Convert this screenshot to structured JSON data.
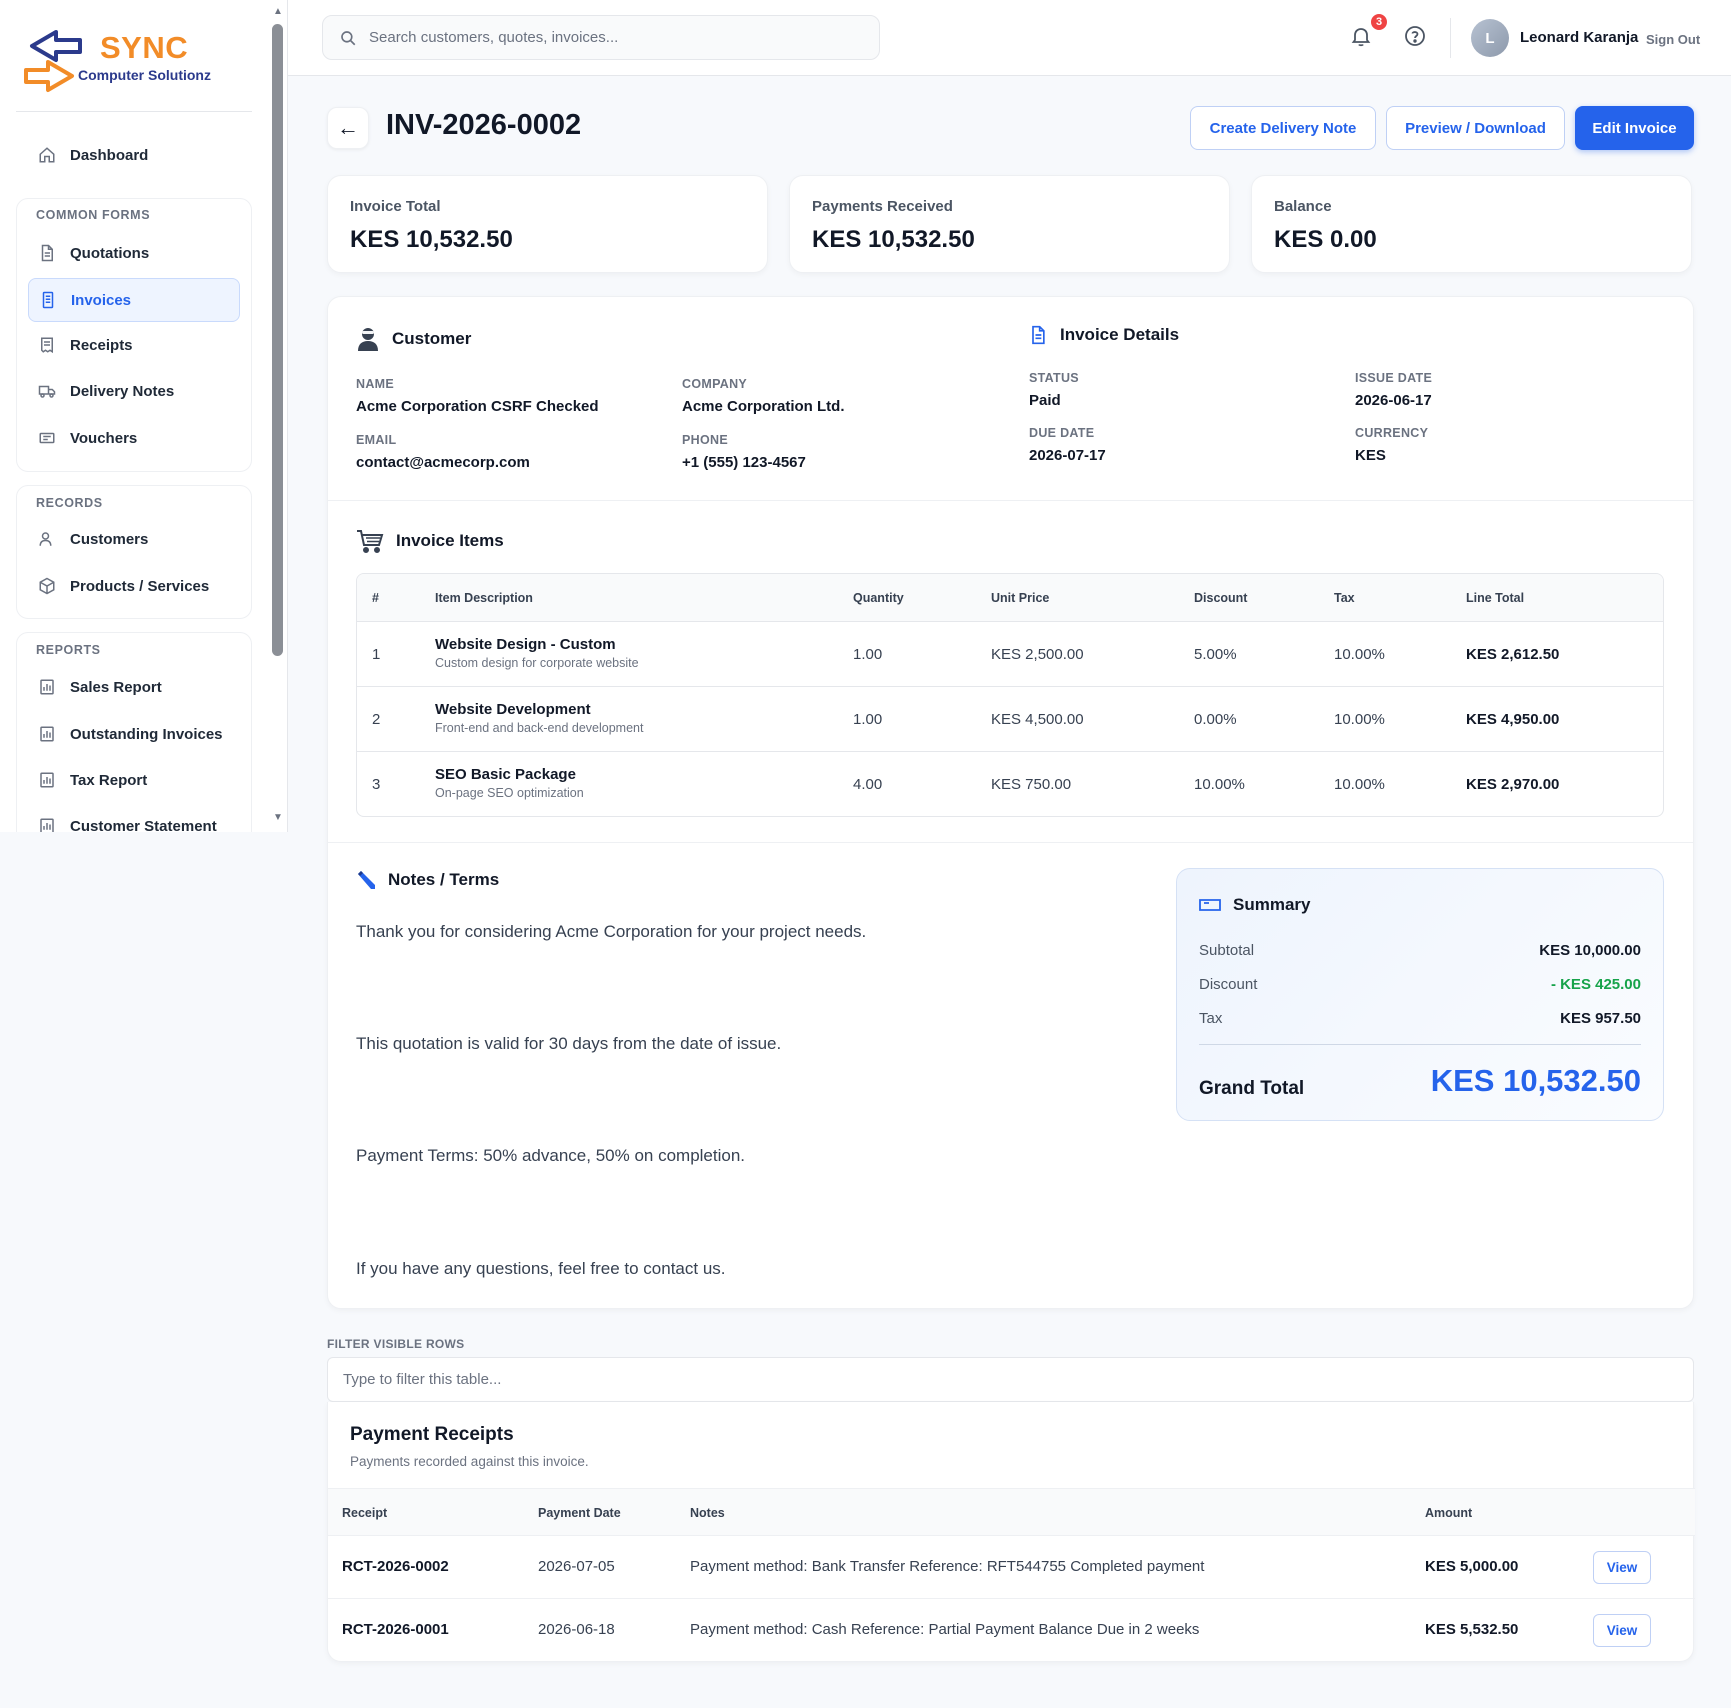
{
  "brand": {
    "name": "SYNC",
    "tagline": "Computer Solutionz",
    "colors": {
      "orange": "#f28c28",
      "navy": "#2b3a8c",
      "accent": "#2563eb",
      "green": "#16a34a",
      "danger": "#ef4444"
    }
  },
  "sidebar": {
    "dashboard": "Dashboard",
    "groups": [
      {
        "title": "COMMON FORMS",
        "items": [
          {
            "label": "Quotations",
            "icon": "document-icon"
          },
          {
            "label": "Invoices",
            "icon": "invoice-icon",
            "active": true
          },
          {
            "label": "Receipts",
            "icon": "receipt-icon"
          },
          {
            "label": "Delivery Notes",
            "icon": "truck-icon"
          },
          {
            "label": "Vouchers",
            "icon": "voucher-icon"
          }
        ]
      },
      {
        "title": "RECORDS",
        "items": [
          {
            "label": "Customers",
            "icon": "user-icon"
          },
          {
            "label": "Products / Services",
            "icon": "box-icon"
          }
        ]
      },
      {
        "title": "REPORTS",
        "items": [
          {
            "label": "Sales Report",
            "icon": "report-icon"
          },
          {
            "label": "Outstanding Invoices",
            "icon": "report-icon"
          },
          {
            "label": "Tax Report",
            "icon": "report-icon"
          },
          {
            "label": "Customer Statement",
            "icon": "report-icon"
          }
        ]
      }
    ]
  },
  "header": {
    "search_placeholder": "Search customers, quotes, invoices...",
    "notification_count": "3",
    "avatar_initial": "L",
    "user_name": "Leonard Karanja",
    "sign_out": "Sign Out"
  },
  "page": {
    "title": "INV-2026-0002",
    "back_glyph": "←",
    "actions": {
      "delivery": "Create Delivery Note",
      "preview": "Preview / Download",
      "edit": "Edit Invoice"
    }
  },
  "stats": [
    {
      "label": "Invoice Total",
      "value": "KES 10,532.50"
    },
    {
      "label": "Payments Received",
      "value": "KES 10,532.50"
    },
    {
      "label": "Balance",
      "value": "KES 0.00"
    }
  ],
  "customer": {
    "heading": "Customer",
    "name_label": "NAME",
    "name": "Acme Corporation CSRF Checked",
    "company_label": "COMPANY",
    "company": "Acme Corporation Ltd.",
    "email_label": "EMAIL",
    "email": "contact@acmecorp.com",
    "phone_label": "PHONE",
    "phone": "+1 (555) 123-4567"
  },
  "invoice_details": {
    "heading": "Invoice Details",
    "status_label": "STATUS",
    "status": "Paid",
    "issue_label": "ISSUE DATE",
    "issue_date": "2026-06-17",
    "due_label": "DUE DATE",
    "due_date": "2026-07-17",
    "currency_label": "CURRENCY",
    "currency": "KES"
  },
  "items": {
    "heading": "Invoice Items",
    "columns": [
      "#",
      "Item Description",
      "Quantity",
      "Unit Price",
      "Discount",
      "Tax",
      "Line Total"
    ],
    "rows": [
      {
        "num": "1",
        "title": "Website Design - Custom",
        "sub": "Custom design for corporate website",
        "qty": "1.00",
        "price": "KES 2,500.00",
        "discount": "5.00%",
        "tax": "10.00%",
        "total": "KES 2,612.50"
      },
      {
        "num": "2",
        "title": "Website Development",
        "sub": "Front-end and back-end development",
        "qty": "1.00",
        "price": "KES 4,500.00",
        "discount": "0.00%",
        "tax": "10.00%",
        "total": "KES 4,950.00"
      },
      {
        "num": "3",
        "title": "SEO Basic Package",
        "sub": "On-page SEO optimization",
        "qty": "4.00",
        "price": "KES 750.00",
        "discount": "10.00%",
        "tax": "10.00%",
        "total": "KES 2,970.00"
      }
    ]
  },
  "notes": {
    "heading": "Notes / Terms",
    "lines": [
      "Thank you for considering Acme Corporation for your project needs.",
      "This quotation is valid for 30 days from the date of issue.",
      "Payment Terms: 50% advance, 50% on completion.",
      "If you have any questions, feel free to contact us."
    ]
  },
  "summary": {
    "heading": "Summary",
    "subtotal_label": "Subtotal",
    "subtotal": "KES 10,000.00",
    "discount_label": "Discount",
    "discount": "- KES 425.00",
    "tax_label": "Tax",
    "tax": "KES 957.50",
    "grand_label": "Grand Total",
    "grand_total": "KES 10,532.50"
  },
  "filter": {
    "label": "FILTER VISIBLE ROWS",
    "placeholder": "Type to filter this table..."
  },
  "receipts": {
    "title": "Payment Receipts",
    "subtitle": "Payments recorded against this invoice.",
    "columns": [
      "Receipt",
      "Payment Date",
      "Notes",
      "Amount"
    ],
    "view_label": "View",
    "rows": [
      {
        "receipt": "RCT-2026-0002",
        "date": "2026-07-05",
        "notes": "Payment method: Bank Transfer Reference: RFT544755 Completed payment",
        "amount": "KES 5,000.00"
      },
      {
        "receipt": "RCT-2026-0001",
        "date": "2026-06-18",
        "notes": "Payment method: Cash Reference: Partial Payment Balance Due in 2 weeks",
        "amount": "KES 5,532.50"
      }
    ]
  }
}
